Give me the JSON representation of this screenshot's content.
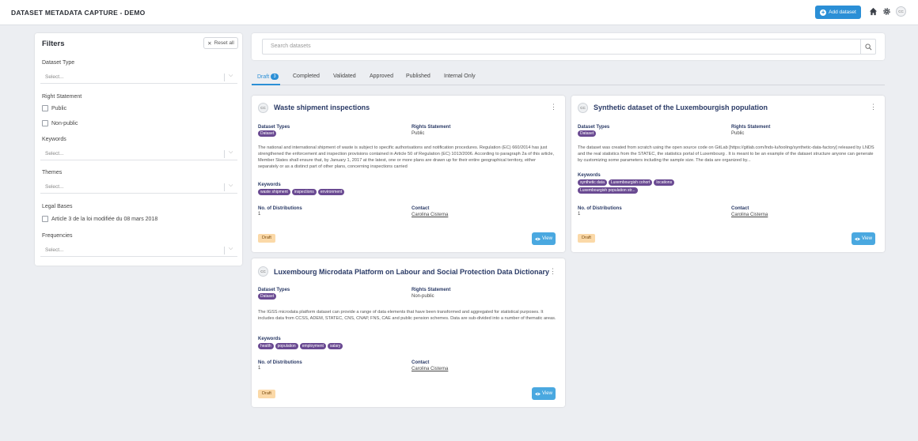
{
  "header": {
    "app_title": "DATASET METADATA CAPTURE - DEMO",
    "add_dataset_label": "Add dataset",
    "user_initials": "CC"
  },
  "filters": {
    "title": "Filters",
    "reset_label": "Reset all",
    "dataset_type": {
      "label": "Dataset Type",
      "placeholder": "Select..."
    },
    "right_statement": {
      "label": "Right Statement",
      "options": [
        "Public",
        "Non-public"
      ]
    },
    "keywords": {
      "label": "Keywords",
      "placeholder": "Select..."
    },
    "themes": {
      "label": "Themes",
      "placeholder": "Select..."
    },
    "legal_bases": {
      "label": "Legal Bases",
      "options": [
        "Article 3 de la loi modifiée du 08 mars 2018"
      ]
    },
    "frequencies": {
      "label": "Frequencies",
      "placeholder": "Select..."
    }
  },
  "search": {
    "placeholder": "Search datasets"
  },
  "tabs": [
    {
      "label": "Draft",
      "count": "3"
    },
    {
      "label": "Completed"
    },
    {
      "label": "Validated"
    },
    {
      "label": "Approved"
    },
    {
      "label": "Published"
    },
    {
      "label": "Internal Only"
    }
  ],
  "labels": {
    "dataset_types": "Dataset Types",
    "rights_statement": "Rights Statement",
    "keywords": "Keywords",
    "num_distributions": "No. of Distributions",
    "contact": "Contact",
    "view": "View"
  },
  "cards": [
    {
      "initials": "CC",
      "title": "Waste shipment inspections",
      "dataset_type": "Dataset",
      "rights": "Public",
      "description": "The national and international shipment of waste is subject to specific authorisations and notification procedures. Regulation (EC) 660/2014 has just strengthened the enforcement and inspection provisions contained in Article 50 of Regulation (EC) 1013/2006. According to paragraph 2a of this article, Member States shall ensure that, by January 1, 2017 at the latest, one or more plans are drawn up for their entire geographical territory, either separately or as a distinct part of other plans, concerning inspections carried",
      "keywords": [
        "waste shipment",
        "inspections",
        "environment"
      ],
      "distributions": "1",
      "contact": "Carolina Cisterna",
      "status": "Draft"
    },
    {
      "initials": "CC",
      "title": "Synthetic dataset of the Luxembourgish population",
      "dataset_type": "Dataset",
      "rights": "Public",
      "description": "The dataset was created from scratch using the open source code on GitLab [https://gitlab.com/lnds-lu/tooling/synthetic-data-factory] released by LNDS and the real statistics from the STATEC, the statistics portal of Luxembourg . It is meant to be an example of the dataset structure anyone can generate by customizing some parameters including the sample size. The data are organized by...",
      "keywords": [
        "synthetic data",
        "Luxembourgish cohort",
        "locations",
        "Luxembourgish population str..."
      ],
      "distributions": "1",
      "contact": "Carolina Cisterna",
      "status": "Draft"
    },
    {
      "initials": "CC",
      "title": "Luxembourg Microdata Platform on Labour and Social Protection Data Dictionary",
      "dataset_type": "Dataset",
      "rights": "Non-public",
      "description": "The IGSS microdata platform dataset can provide a range of data elements that have been transformed and aggregated for statistical purposes. It includes data from CCSS, ADEM, STATEC, CNS, CNAP, FNS, CAE and public pension schemes. Data are sub-divided into a number of thematic areas.",
      "keywords": [
        "health",
        "population",
        "employment",
        "salary"
      ],
      "distributions": "1",
      "contact": "Carolina Cisterna",
      "status": "Draft"
    }
  ]
}
